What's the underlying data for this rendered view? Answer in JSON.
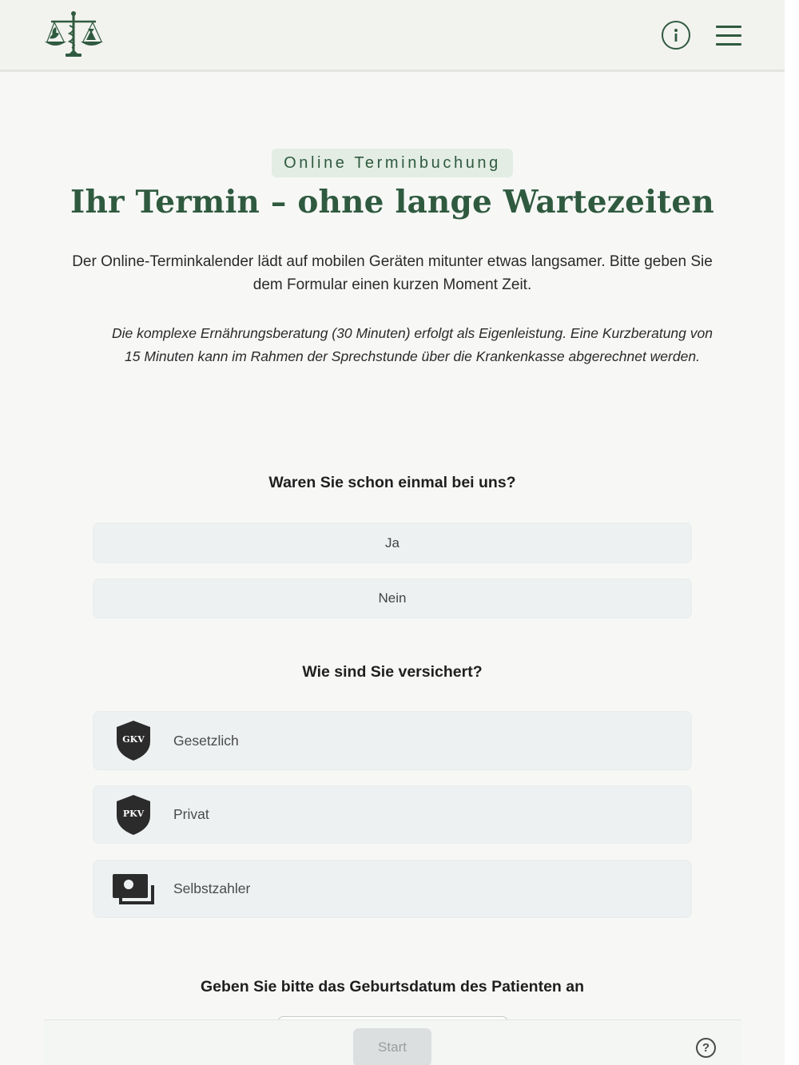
{
  "header": {
    "logo_icon": "scales-caduceus-logo-icon",
    "info_icon": "info-icon",
    "menu_icon": "hamburger-menu-icon",
    "accent_color": "#2f5a3f"
  },
  "hero": {
    "eyebrow": "Online Terminbuchung",
    "title": "Ihr Termin – ohne lange Wartezeiten",
    "intro": "Der Online-Terminkalender lädt auf mobilen Geräten mitunter etwas langsamer. Bitte geben Sie dem Formular einen kurzen Moment Zeit.",
    "note": "Die komplexe Ernährungsberatung (30 Minuten) erfolgt als Eigenleistung. Eine Kurzberatung von 15 Minuten kann im Rahmen der Sprechstunde über die Krankenkasse abgerechnet werden."
  },
  "form": {
    "visit_question": "Waren Sie schon einmal bei uns?",
    "visit_options": [
      "Ja",
      "Nein"
    ],
    "insurance_question": "Wie sind Sie versichert?",
    "insurance_options": [
      {
        "label": "Gesetzlich",
        "badge": "GKV",
        "icon": "shield-gkv-icon"
      },
      {
        "label": "Privat",
        "badge": "PKV",
        "icon": "shield-pkv-icon"
      },
      {
        "label": "Selbstzahler",
        "icon": "cash-icon"
      }
    ],
    "birthdate_question": "Geben Sie bitte das Geburtsdatum des Patienten an"
  },
  "footer": {
    "start_label": "Start",
    "help_symbol": "?"
  }
}
